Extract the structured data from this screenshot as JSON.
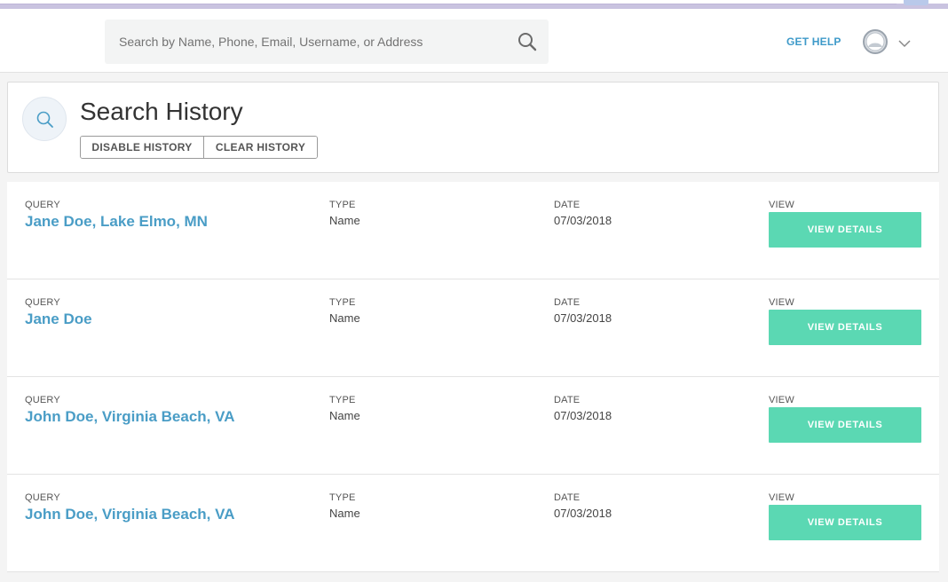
{
  "header": {
    "search_placeholder": "Search by Name, Phone, Email, Username, or Address",
    "search_value": "",
    "get_help": "GET HELP"
  },
  "history": {
    "title": "Search History",
    "disable_label": "DISABLE HISTORY",
    "clear_label": "CLEAR HISTORY"
  },
  "columns": {
    "query": "QUERY",
    "type": "TYPE",
    "date": "DATE",
    "view": "VIEW"
  },
  "rows": [
    {
      "query": "Jane Doe, Lake Elmo, MN",
      "type": "Name",
      "date": "07/03/2018",
      "button": "VIEW DETAILS"
    },
    {
      "query": "Jane Doe",
      "type": "Name",
      "date": "07/03/2018",
      "button": "VIEW DETAILS"
    },
    {
      "query": "John Doe, Virginia Beach, VA",
      "type": "Name",
      "date": "07/03/2018",
      "button": "VIEW DETAILS"
    },
    {
      "query": "John Doe, Virginia Beach, VA",
      "type": "Name",
      "date": "07/03/2018",
      "button": "VIEW DETAILS"
    }
  ],
  "colors": {
    "accent_link": "#4a9dc6",
    "view_button": "#5bd8b3",
    "get_help": "#3e9ac9"
  },
  "icons": {
    "search": "search-icon",
    "avatar": "avatar",
    "chevron": "chevron-down-icon",
    "history": "search-icon"
  }
}
